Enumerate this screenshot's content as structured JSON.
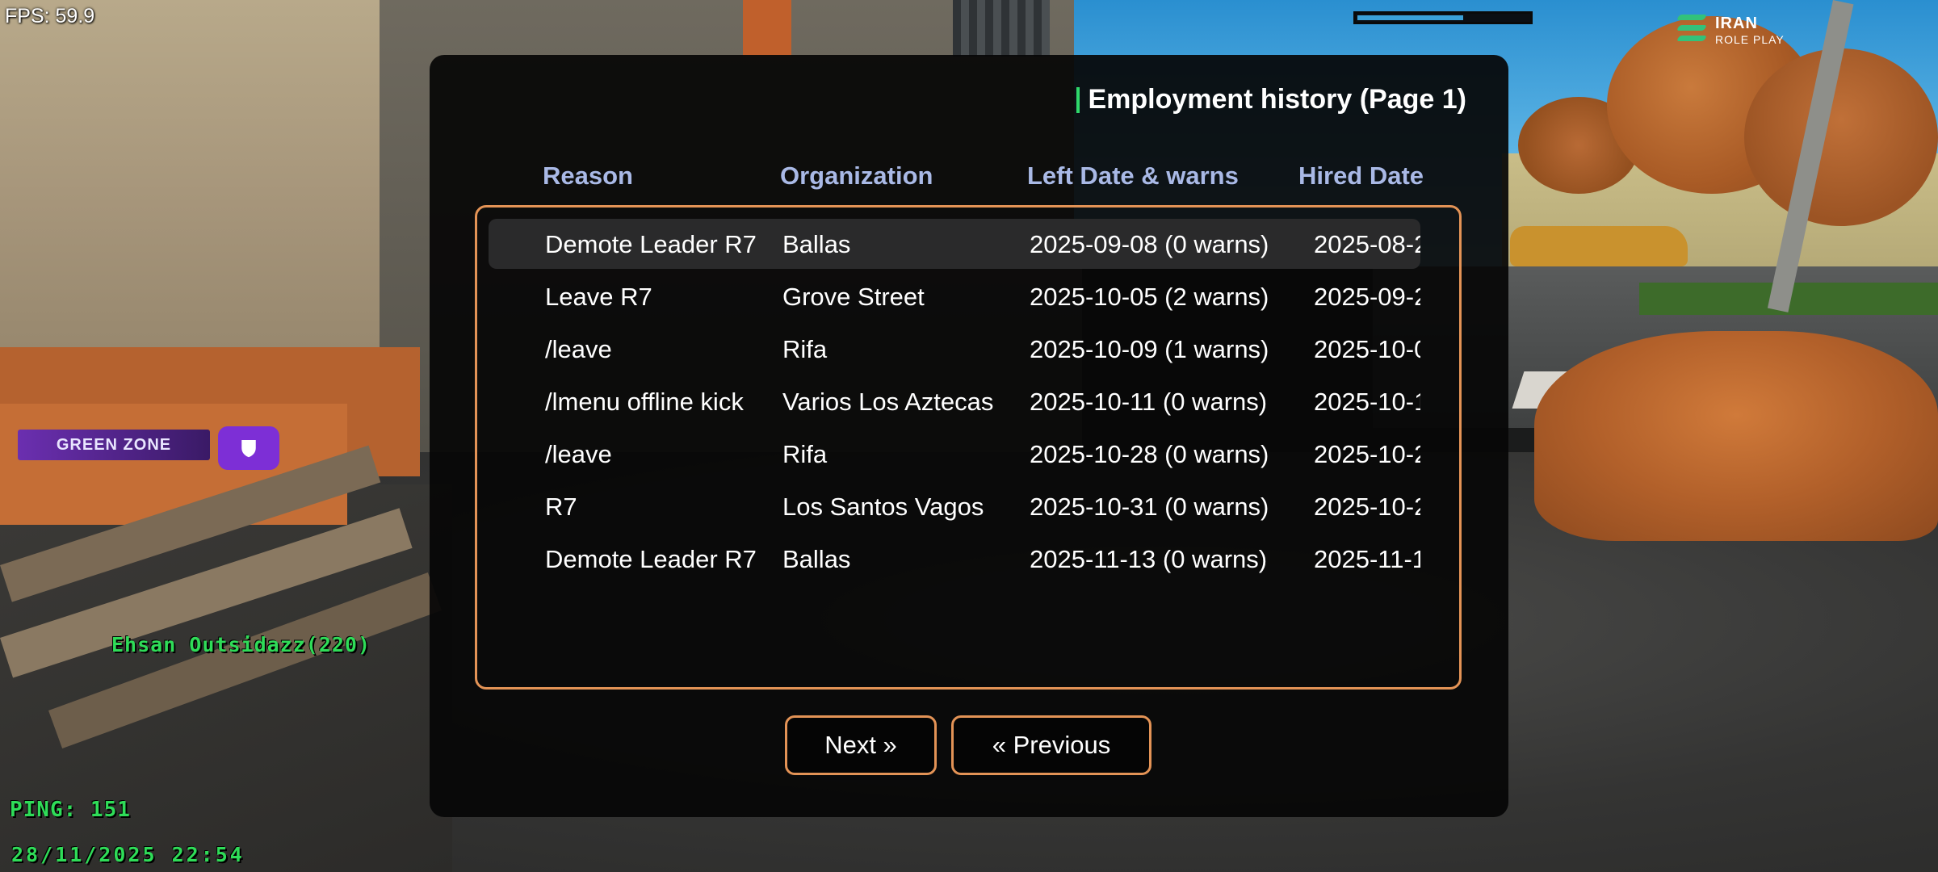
{
  "hud": {
    "fps": "FPS: 59.9",
    "health_bar_fill": 0.62,
    "logo_line1": "IRAN",
    "logo_line2": "ROLE PLAY",
    "zone_label": "GREEN ZONE",
    "zone_icon": "shield-icon",
    "player_tag": "Ehsan Outsidazz(220)",
    "ping": "PING: 151",
    "datetime": "28/11/2025 22:54"
  },
  "dialog": {
    "title": "Employment history (Page 1)",
    "columns": [
      "Reason",
      "Organization",
      "Left Date & warns",
      "Hired Date"
    ],
    "rows": [
      {
        "reason": "Demote Leader R7",
        "organization": "Ballas",
        "left": "2025-09-08 (0 warns)",
        "hired": "2025-08-2"
      },
      {
        "reason": "Leave R7",
        "organization": "Grove Street",
        "left": "2025-10-05 (2 warns)",
        "hired": "2025-09-2"
      },
      {
        "reason": "/leave",
        "organization": "Rifa",
        "left": "2025-10-09 (1 warns)",
        "hired": "2025-10-0"
      },
      {
        "reason": "/lmenu offline kick",
        "organization": "Varios Los Aztecas",
        "left": "2025-10-11 (0 warns)",
        "hired": "2025-10-1"
      },
      {
        "reason": "/leave",
        "organization": "Rifa",
        "left": "2025-10-28 (0 warns)",
        "hired": "2025-10-2"
      },
      {
        "reason": "R7",
        "organization": "Los Santos Vagos",
        "left": "2025-10-31 (0 warns)",
        "hired": "2025-10-2"
      },
      {
        "reason": "Demote Leader R7",
        "organization": "Ballas",
        "left": "2025-11-13 (0 warns)",
        "hired": "2025-11-1"
      }
    ],
    "selected_row": 0,
    "next_label": "Next »",
    "prev_label": "« Previous"
  },
  "colors": {
    "accent_border": "#e39356",
    "header_text": "#a9b9e6",
    "title_marker": "#2fd86a",
    "hud_green": "#2fdc58",
    "zone_purple": "#7d2fd6"
  }
}
